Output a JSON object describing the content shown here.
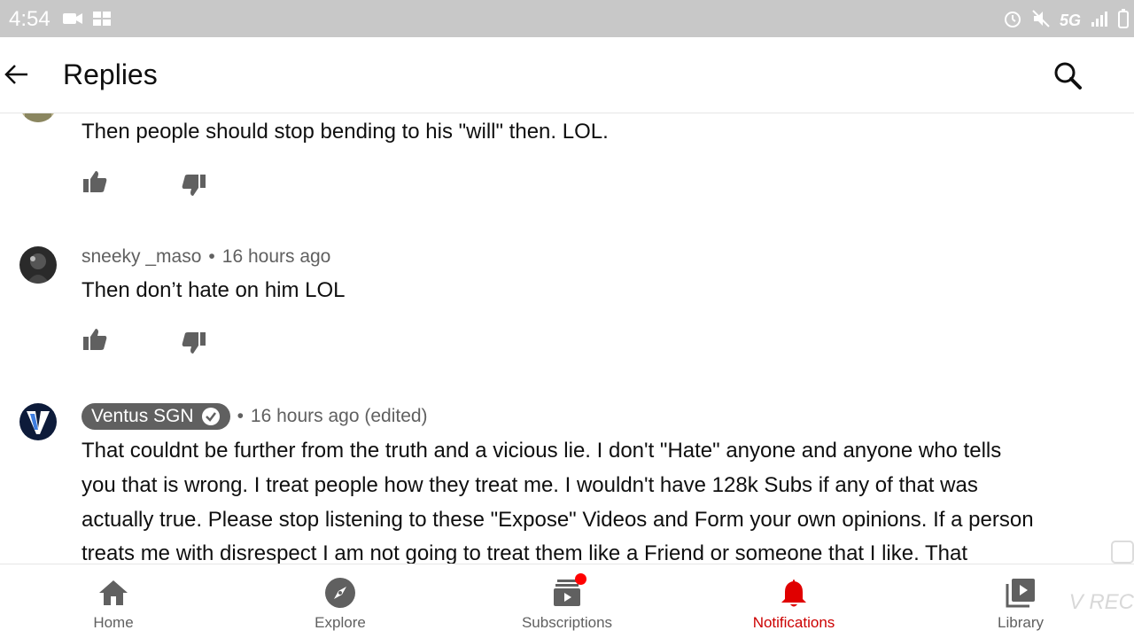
{
  "status_bar": {
    "time": "4:54",
    "network": "5G"
  },
  "header": {
    "title": "Replies"
  },
  "comments": [
    {
      "text": "Then people should stop bending to his \"will\" then. LOL."
    },
    {
      "author": "sneeky _maso",
      "time": "16 hours ago",
      "text": "Then don’t hate on him LOL"
    },
    {
      "author": "Ventus SGN",
      "time": "16 hours ago (edited)",
      "text_lines": [
        "That couldnt be further from the truth and a vicious lie. I don't \"Hate\" anyone and anyone who tells",
        "you that is wrong. I treat people how they treat me. I wouldn't have 128k Subs if any of that was",
        "actually true. Please stop listening to these \"Expose\" Videos and Form your own opinions. If a person",
        "treats me with disrespect I am not going to treat them like a Friend or someone that I like. That"
      ]
    }
  ],
  "nav": {
    "items": [
      {
        "label": "Home",
        "icon": "home-icon"
      },
      {
        "label": "Explore",
        "icon": "compass-icon"
      },
      {
        "label": "Subscriptions",
        "icon": "subscriptions-icon"
      },
      {
        "label": "Notifications",
        "icon": "bell-icon",
        "active": true
      },
      {
        "label": "Library",
        "icon": "library-icon"
      }
    ]
  },
  "watermark": "V REC",
  "colors": {
    "accent": "#cc0000",
    "notification_dot": "#ff0000",
    "meta_text": "#606060",
    "status_bar": "#c8c8c8"
  }
}
